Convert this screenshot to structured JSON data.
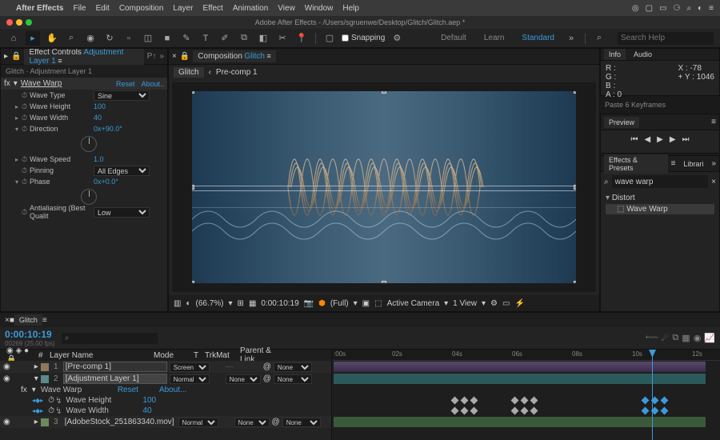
{
  "menubar": {
    "app": "After Effects",
    "items": [
      "File",
      "Edit",
      "Composition",
      "Layer",
      "Effect",
      "Animation",
      "View",
      "Window",
      "Help"
    ]
  },
  "document": {
    "title": "Adobe After Effects - /Users/sgruenwe/Desktop/Glitch/Glitch.aep *"
  },
  "toolbar": {
    "snapping": "Snapping",
    "workspaces": [
      "Default",
      "Learn",
      "Standard"
    ],
    "active_ws": "Standard",
    "search_placeholder": "Search Help"
  },
  "effect_controls": {
    "tab": "Effect Controls",
    "layer_link": "Adjustment Layer 1",
    "header": "Glitch · Adjustment Layer 1",
    "effect_name": "Wave Warp",
    "reset": "Reset",
    "about": "About..",
    "props": {
      "wave_type": {
        "label": "Wave Type",
        "value": "Sine"
      },
      "wave_height": {
        "label": "Wave Height",
        "value": "100"
      },
      "wave_width": {
        "label": "Wave Width",
        "value": "40"
      },
      "direction": {
        "label": "Direction",
        "value": "0x+90.0°"
      },
      "wave_speed": {
        "label": "Wave Speed",
        "value": "1.0"
      },
      "pinning": {
        "label": "Pinning",
        "value": "All Edges"
      },
      "phase": {
        "label": "Phase",
        "value": "0x+0.0°"
      },
      "antialiasing": {
        "label": "Antialiasing (Best Qualit",
        "value": "Low"
      }
    }
  },
  "composition": {
    "tab": "Composition",
    "name": "Glitch",
    "crumb1": "Glitch",
    "crumb2": "Pre-comp 1",
    "controls": {
      "zoom": "(66.7%)",
      "time": "0:00:10:19",
      "res": "(Full)",
      "camera": "Active Camera",
      "views": "1 View"
    }
  },
  "info": {
    "tab1": "Info",
    "tab2": "Audio",
    "r": "R :",
    "g": "G :",
    "b": "B :",
    "a": "A : 0",
    "x": "X : -78",
    "y": "Y : 1046",
    "plus": "+",
    "paste": "Paste 6 Keyframes"
  },
  "preview": {
    "tab": "Preview"
  },
  "effects_presets": {
    "tab1": "Effects & Presets",
    "tab2": "Librari",
    "search": "wave warp",
    "category": "Distort",
    "item": "Wave Warp"
  },
  "timeline": {
    "tab": "Glitch",
    "timecode": "0:00:10:19",
    "frames": "00269 (25.00 fps)",
    "cols": {
      "layer": "Layer Name",
      "mode": "Mode",
      "t": "T",
      "trkmat": "TrkMat",
      "parent": "Parent & Link"
    },
    "ticks": [
      ":00s",
      "02s",
      "04s",
      "06s",
      "08s",
      "10s",
      "12s"
    ],
    "layers": [
      {
        "num": "1",
        "name": "[Pre-comp 1]",
        "mode": "Screen",
        "trkmat": "",
        "parent": "None",
        "color": "#8a7a5a"
      },
      {
        "num": "2",
        "name": "[Adjustment Layer 1]",
        "mode": "Normal",
        "trkmat": "None",
        "parent": "None",
        "color": "#5a8a8a"
      },
      {
        "num": "3",
        "name": "[AdobeStock_251863340.mov]",
        "mode": "Normal",
        "trkmat": "None",
        "parent": "None",
        "color": "#6a8a5a"
      }
    ],
    "layer2_fx": {
      "name": "Wave Warp",
      "reset": "Reset",
      "about": "About...",
      "height": {
        "label": "Wave Height",
        "value": "100"
      },
      "width": {
        "label": "Wave Width",
        "value": "40"
      }
    },
    "none": "None"
  }
}
